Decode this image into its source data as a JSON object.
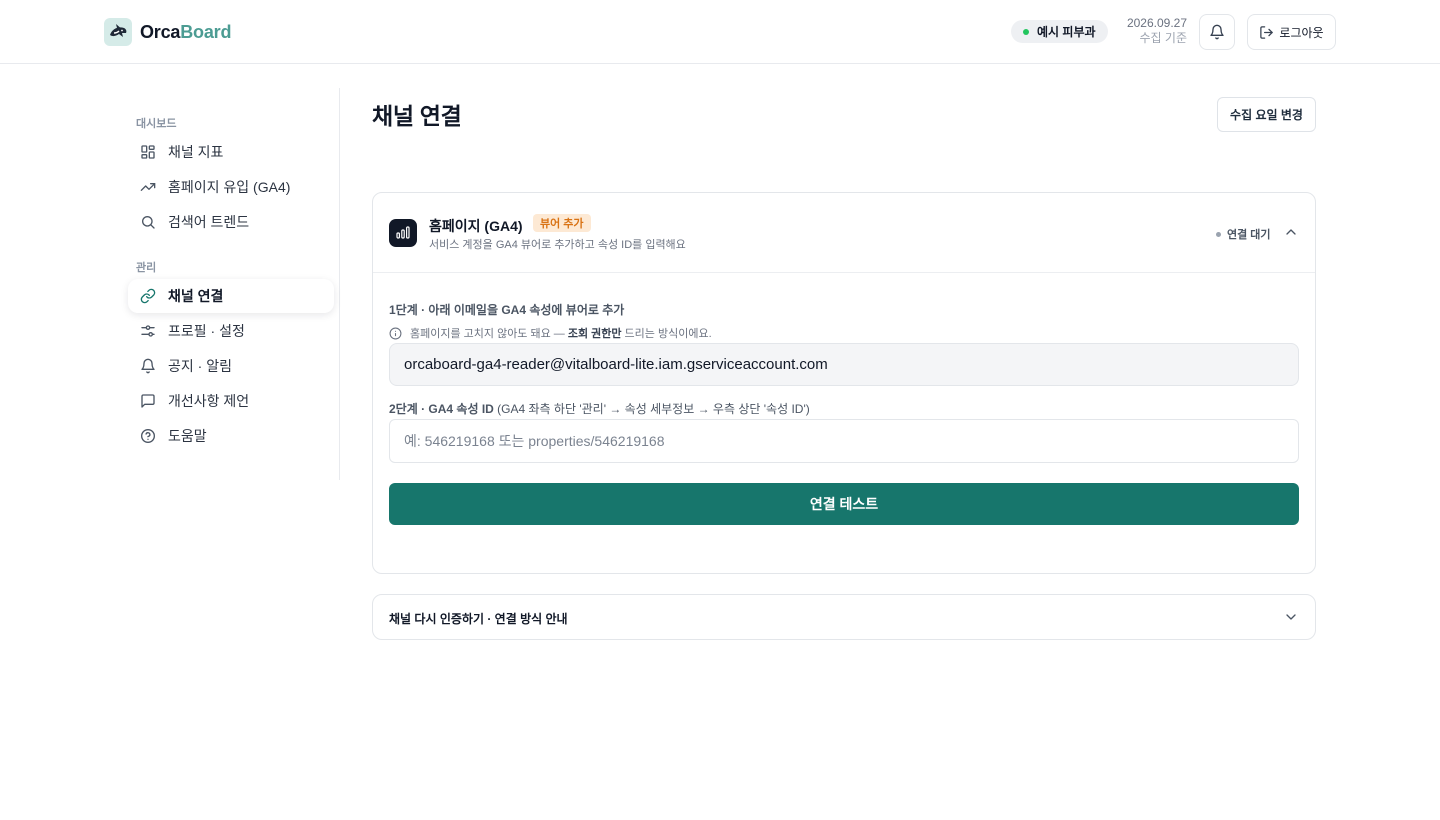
{
  "app": {
    "brand_a": "Orca",
    "brand_b": "Board",
    "clinic_name": "예시 피부과",
    "date": "2026.09.27",
    "date_caption": "수집 기준",
    "logout_label": "로그아웃"
  },
  "sidebar": {
    "section_dashboard": "대시보드",
    "section_manage": "관리",
    "items": [
      {
        "label": "채널 지표",
        "icon": "grid-icon"
      },
      {
        "label": "홈페이지 유입 (GA4)",
        "icon": "trending-up-icon"
      },
      {
        "label": "검색어 트렌드",
        "icon": "search-icon"
      },
      {
        "label": "채널 연결",
        "icon": "link-icon",
        "active": true
      },
      {
        "label": "프로필 · 설정",
        "icon": "sliders-icon"
      },
      {
        "label": "공지 · 알림",
        "icon": "bell-icon"
      },
      {
        "label": "개선사항 제언",
        "icon": "chat-icon"
      },
      {
        "label": "도움말",
        "icon": "help-icon"
      }
    ]
  },
  "main": {
    "title": "채널 연결",
    "change_button": "수집 요일 변경",
    "ga_card": {
      "title": "홈페이지 (GA4)",
      "badge": "뷰어 추가",
      "description": "서비스 계정을 GA4 뷰어로 추가하고 속성 ID를 입력해요",
      "status": "연결 대기",
      "step1_title": "1단계 · 아래 이메일을 GA4 속성에 뷰어로 추가",
      "info_prefix": "홈페이지를 고치지 않아도 돼요 — ",
      "info_bold": "조회 권한만",
      "info_suffix": " 드리는 방식이에요.",
      "service_email": "orcaboard-ga4-reader@vitalboard-lite.iam.gserviceaccount.com",
      "step2_bold": "2단계 · GA4 속성 ID",
      "step2_hint": " (GA4 좌측 하단 '관리' → 속성 세부정보 → 우측 상단 '속성 ID')",
      "property_placeholder": "예: 546219168 또는 properties/546219168",
      "property_value": "",
      "test_button": "연결 테스트"
    },
    "reauth_card": {
      "title": "채널 다시 인증하기 · 연결 방식 안내"
    }
  },
  "colors": {
    "accent": "#17766c",
    "brand": "#4c9c93",
    "badge_text": "#d97315",
    "badge_bg": "#fde9d4",
    "online": "#22c55e"
  }
}
